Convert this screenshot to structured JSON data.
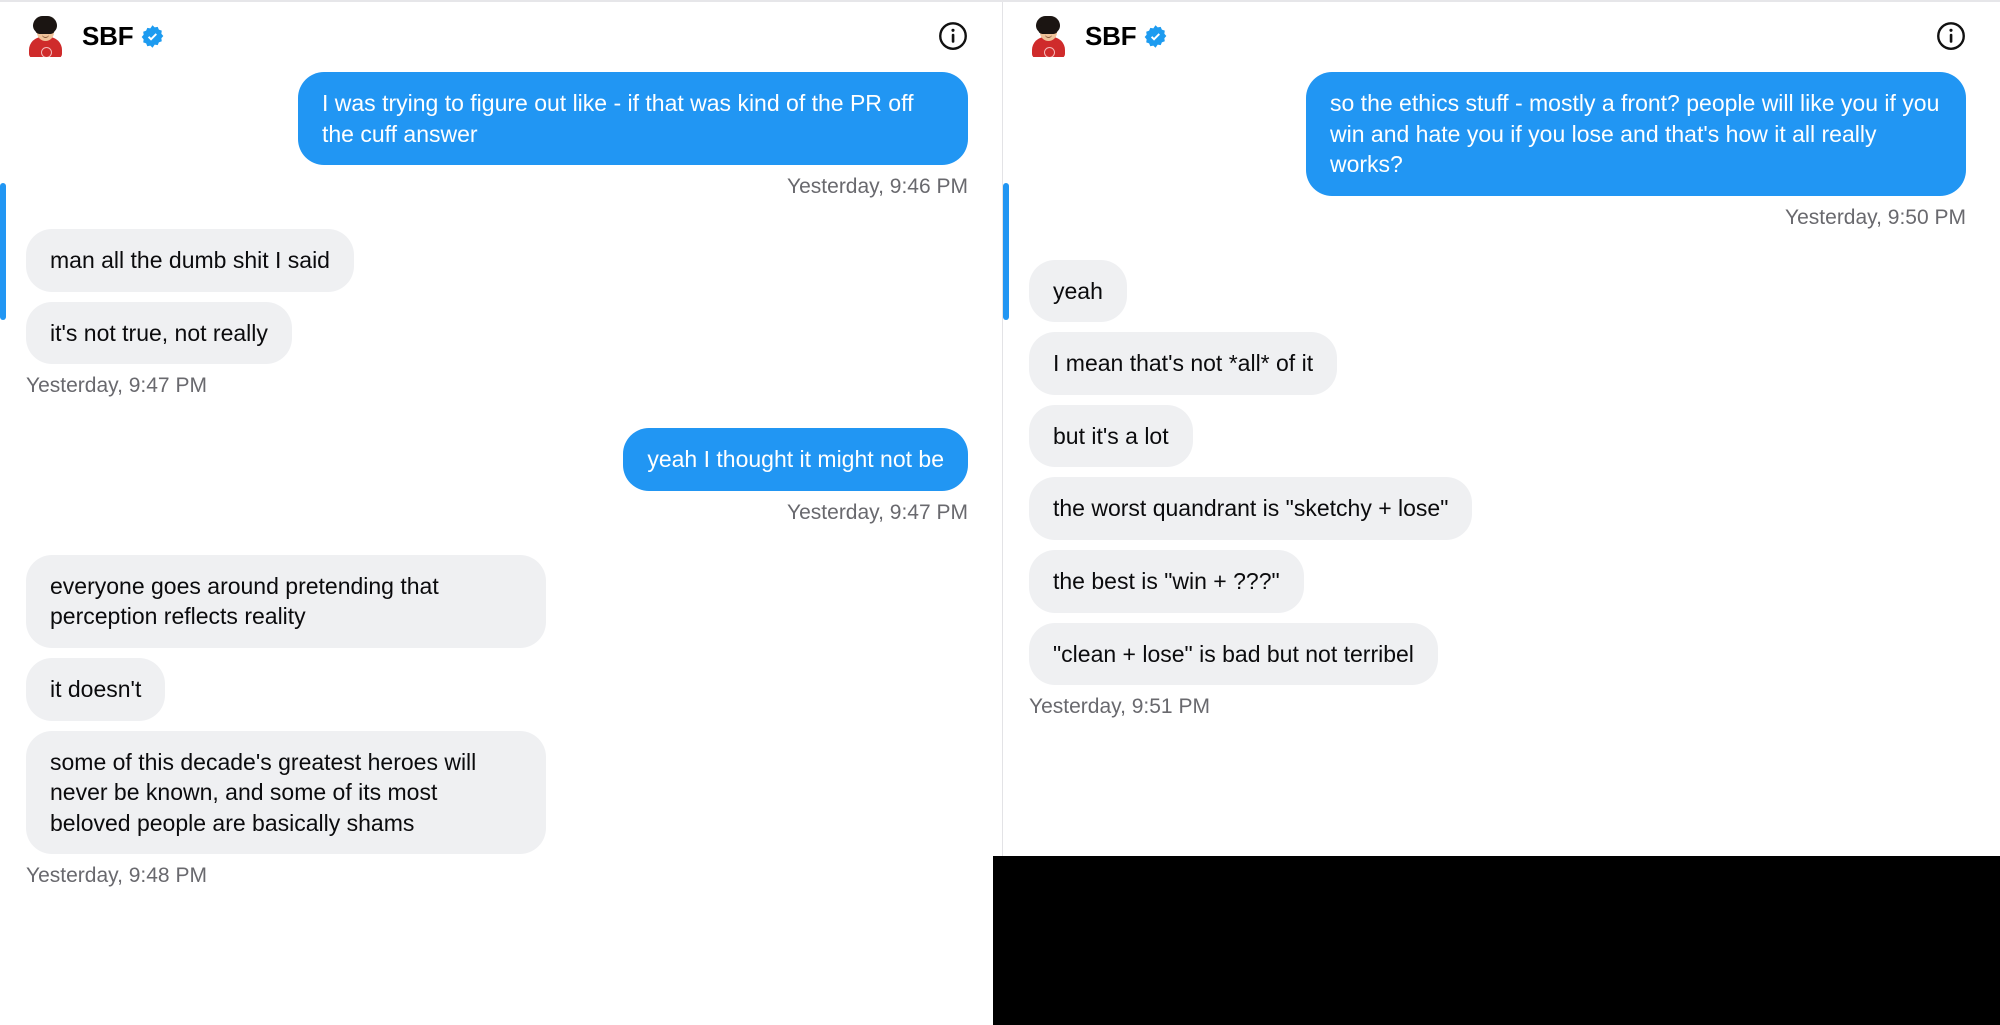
{
  "conversation": {
    "contact_name": "SBF",
    "verified": true,
    "avatar_icon": "avatar-illustration",
    "info_icon": "info-circle-icon"
  },
  "panels": [
    {
      "id": "left",
      "messages": [
        {
          "direction": "out",
          "text": "I was trying to figure out like - if that was kind of the PR off the cuff answer",
          "timestamp": "Yesterday, 9:46 PM"
        },
        {
          "direction": "in",
          "text": "man all the dumb shit I said",
          "timestamp": null
        },
        {
          "direction": "in",
          "text": "it's not true, not really",
          "timestamp": "Yesterday, 9:47 PM"
        },
        {
          "direction": "out",
          "text": "yeah I thought it might not be",
          "timestamp": "Yesterday, 9:47 PM"
        },
        {
          "direction": "in",
          "text": "everyone goes around pretending that perception reflects reality",
          "timestamp": null
        },
        {
          "direction": "in",
          "text": "it doesn't",
          "timestamp": null
        },
        {
          "direction": "in",
          "text": "some of this decade's greatest heroes will never be known, and some of its most beloved people are basically shams",
          "timestamp": "Yesterday, 9:48 PM"
        }
      ]
    },
    {
      "id": "right",
      "messages": [
        {
          "direction": "out",
          "text": "so the ethics stuff - mostly a front? people will like you if you win and hate you if you lose and that's how it all really works?",
          "timestamp": "Yesterday, 9:50 PM"
        },
        {
          "direction": "in",
          "text": "yeah",
          "timestamp": null
        },
        {
          "direction": "in",
          "text": "I mean that's not *all* of it",
          "timestamp": null
        },
        {
          "direction": "in",
          "text": "but it's a lot",
          "timestamp": null
        },
        {
          "direction": "in",
          "text": "the worst quandrant is \"sketchy + lose\"",
          "timestamp": null
        },
        {
          "direction": "in",
          "text": "the best is \"win + ???\"",
          "timestamp": null
        },
        {
          "direction": "in",
          "text": "\"clean + lose\" is bad but not terribel",
          "timestamp": "Yesterday, 9:51 PM"
        }
      ]
    }
  ],
  "colors": {
    "outgoing_bubble": "#2196f3",
    "incoming_bubble": "#eff0f2",
    "verified_badge": "#1d9bf0",
    "scroll_indicator": "#2196f3",
    "timestamp_text": "#69696e"
  }
}
